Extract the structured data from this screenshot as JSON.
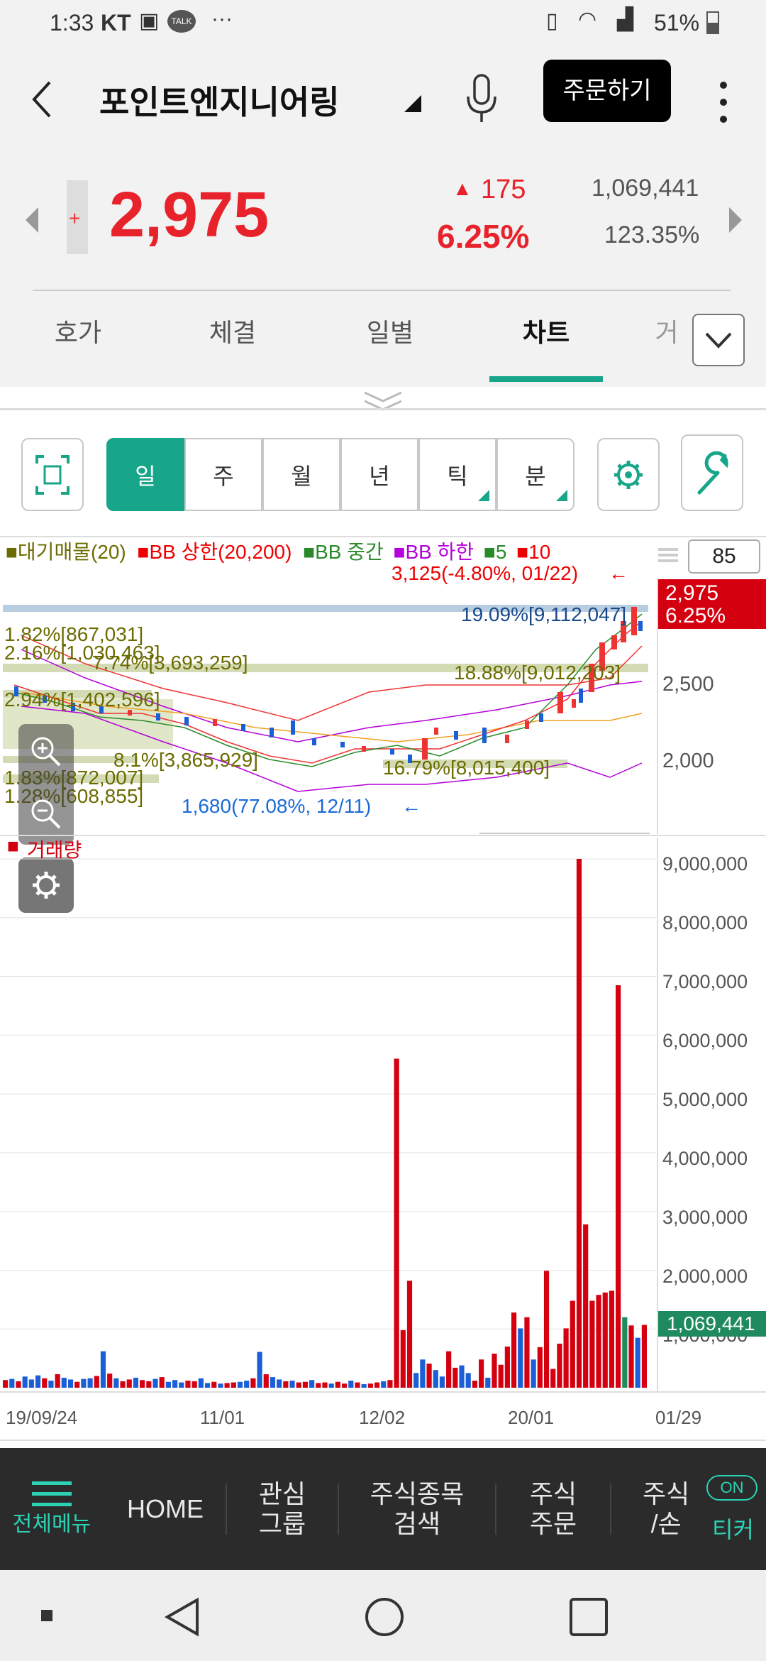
{
  "status": {
    "time": "1:33",
    "carrier": "KT",
    "battery": "51%"
  },
  "header": {
    "stock_name": "포인트엔지니어링",
    "order_button": "주문하기"
  },
  "quote": {
    "price": "2,975",
    "change": "175",
    "change_pct": "6.25%",
    "volume": "1,069,441",
    "volume_ratio": "123.35%"
  },
  "tabs": [
    "호가",
    "체결",
    "일별",
    "차트",
    "거"
  ],
  "active_tab": "차트",
  "period_buttons": [
    "일",
    "주",
    "월",
    "년",
    "틱",
    "분"
  ],
  "chart": {
    "legend": {
      "vp": "대기매물(20)",
      "bb_upper": "BB 상한(20,200)",
      "bb_mid": "BB 중간",
      "bb_lower": "BB 하한",
      "ma5": "5",
      "ma10": "10"
    },
    "period_value": "85",
    "high_note": "3,125(-4.80%, 01/22)",
    "low_note": "1,680(77.08%, 12/11)",
    "price_tag": "2,975",
    "pct_tag": "6.25%",
    "vp_labels": [
      "19.09%[9,112,047]",
      "1.82%[867,031]",
      "2.16%[1,030,463]",
      "7.74%[3,693,259]",
      "18.88%[9,012,203]",
      "2.94%[1,402,596]",
      "8.1%[3,865,929]",
      "16.79%[8,015,400]",
      "1.83%[872,007]",
      "1.28%[608,855]"
    ],
    "price_axis": [
      "2,500",
      "2,000"
    ],
    "volume_title": "거래량",
    "volume_axis": [
      "9,000,000",
      "8,000,000",
      "7,000,000",
      "6,000,000",
      "5,000,000",
      "4,000,000",
      "3,000,000",
      "2,000,000",
      "1,000,000"
    ],
    "volume_tag": "1,069,441",
    "dates": [
      "19/09/24",
      "11/01",
      "12/02",
      "20/01",
      "01/29"
    ]
  },
  "chart_data": {
    "type": "bar",
    "title": "거래량",
    "ylim": [
      0,
      9000000
    ],
    "x_ticks": [
      "19/09/24",
      "11/01",
      "12/02",
      "20/01",
      "01/29"
    ],
    "values": [
      130000,
      150000,
      110000,
      190000,
      140000,
      210000,
      160000,
      120000,
      230000,
      170000,
      140000,
      100000,
      150000,
      160000,
      200000,
      620000,
      240000,
      160000,
      110000,
      140000,
      170000,
      130000,
      110000,
      150000,
      180000,
      100000,
      130000,
      90000,
      120000,
      110000,
      160000,
      80000,
      100000,
      70000,
      80000,
      90000,
      100000,
      120000,
      160000,
      610000,
      230000,
      180000,
      140000,
      110000,
      120000,
      90000,
      100000,
      130000,
      80000,
      90000,
      70000,
      100000,
      70000,
      120000,
      90000,
      60000,
      70000,
      90000,
      110000,
      130000,
      5600000,
      980000,
      1820000,
      250000,
      480000,
      410000,
      300000,
      190000,
      620000,
      340000,
      380000,
      250000,
      120000,
      480000,
      170000,
      580000,
      390000,
      700000,
      1280000,
      1010000,
      1200000,
      480000,
      690000,
      1990000,
      320000,
      750000,
      1010000,
      1480000,
      9000000,
      2780000,
      1480000,
      1580000,
      1620000,
      1650000,
      6850000,
      1200000,
      1060000,
      850000,
      1069441
    ],
    "colors": [
      "red",
      "blue",
      "red",
      "blue",
      "blue",
      "blue",
      "red",
      "blue",
      "red",
      "blue",
      "blue",
      "red",
      "blue",
      "blue",
      "red",
      "blue",
      "red",
      "blue",
      "red",
      "red",
      "blue",
      "red",
      "red",
      "blue",
      "red",
      "blue",
      "blue",
      "blue",
      "red",
      "red",
      "blue",
      "blue",
      "red",
      "blue",
      "red",
      "red",
      "blue",
      "blue",
      "red",
      "blue",
      "red",
      "blue",
      "blue",
      "red",
      "blue",
      "red",
      "red",
      "blue",
      "red",
      "red",
      "blue",
      "red",
      "red",
      "blue",
      "red",
      "blue",
      "red",
      "red",
      "blue",
      "red",
      "red",
      "red",
      "red",
      "blue",
      "blue",
      "red",
      "blue",
      "blue",
      "red",
      "red",
      "blue",
      "blue",
      "red",
      "red",
      "blue",
      "red",
      "red",
      "red",
      "red",
      "blue",
      "red",
      "blue",
      "red",
      "red",
      "red",
      "red",
      "red",
      "red",
      "red",
      "red",
      "red",
      "red",
      "red",
      "red",
      "red",
      "green",
      "red",
      "blue",
      "red"
    ],
    "last_volume": 1069441
  },
  "bottom_nav": {
    "menu": "전체메뉴",
    "home": "HOME",
    "watch": "관심\n그룹",
    "search": "주식종목\n검색",
    "order": "주식\n주문",
    "balance": "주식\n/손",
    "ticker_on": "ON",
    "ticker": "티커"
  }
}
